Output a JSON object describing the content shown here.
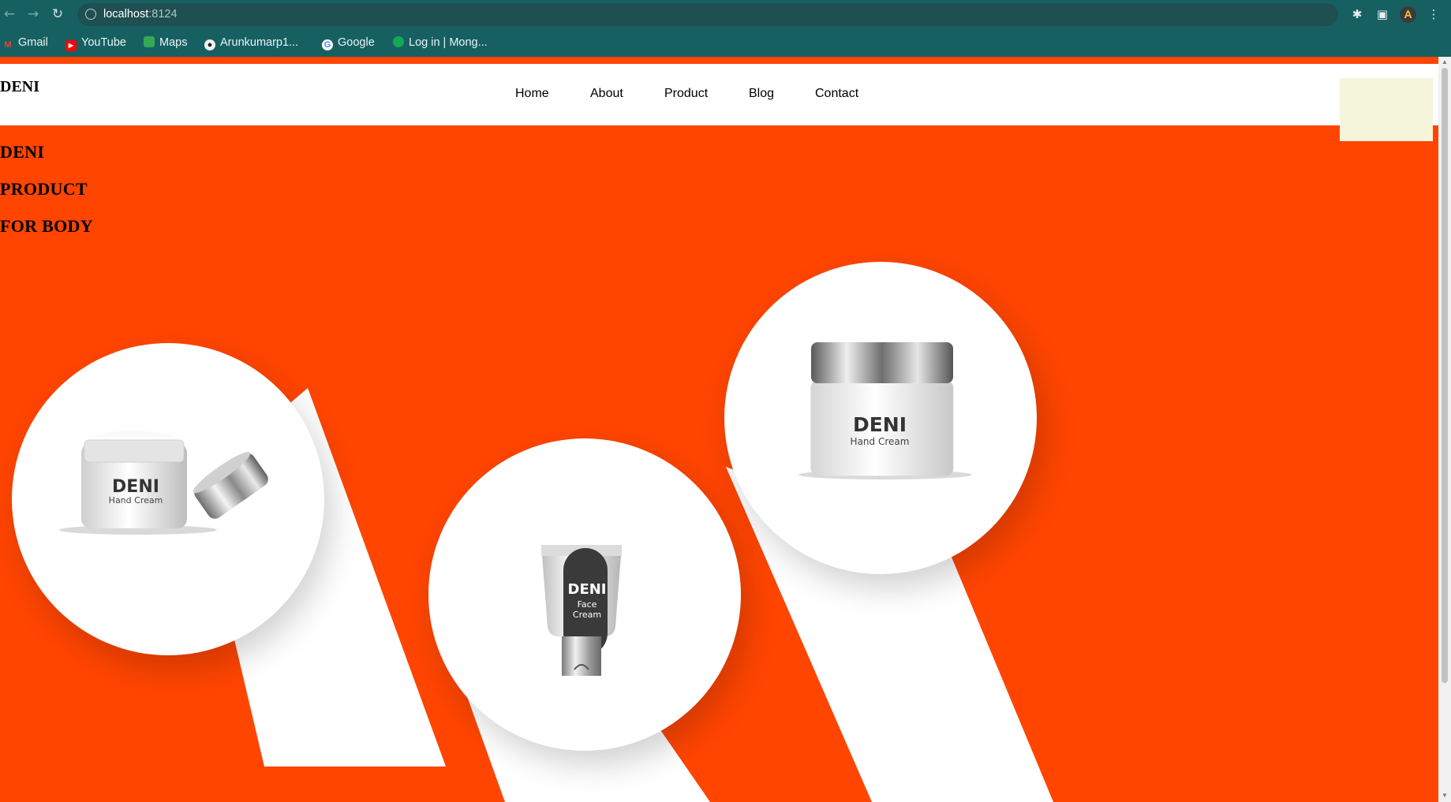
{
  "browser": {
    "url_host": "localhost",
    "url_port": ":8124",
    "bookmarks": [
      {
        "label": "Gmail",
        "icon": "gmail-icon"
      },
      {
        "label": "YouTube",
        "icon": "youtube-icon"
      },
      {
        "label": "Maps",
        "icon": "maps-icon"
      },
      {
        "label": "Arunkumarp1...",
        "icon": "github-icon"
      },
      {
        "label": "Google",
        "icon": "google-icon"
      },
      {
        "label": "Log in | Mong...",
        "icon": "mongodb-icon"
      }
    ],
    "profile_initial": "A"
  },
  "header": {
    "logo": "DENI",
    "nav": [
      "Home",
      "About",
      "Product",
      "Blog",
      "Contact"
    ],
    "icons": [
      "user-icon",
      "cart-icon",
      "search-icon"
    ]
  },
  "hero": {
    "lines": [
      "DENI",
      "PRODUCT",
      "FOR BODY"
    ]
  },
  "products": [
    {
      "brand": "DENI",
      "name": "Hand Cream",
      "kind": "open-jar"
    },
    {
      "brand": "DENI",
      "name_line1": "Face",
      "name_line2": "Cream",
      "kind": "tube"
    },
    {
      "brand": "DENI",
      "name": "Hand Cream",
      "kind": "jar"
    }
  ],
  "colors": {
    "brand_bg": "#ff4500",
    "chrome": "#176062",
    "dropdown": "#f5f5dc"
  }
}
